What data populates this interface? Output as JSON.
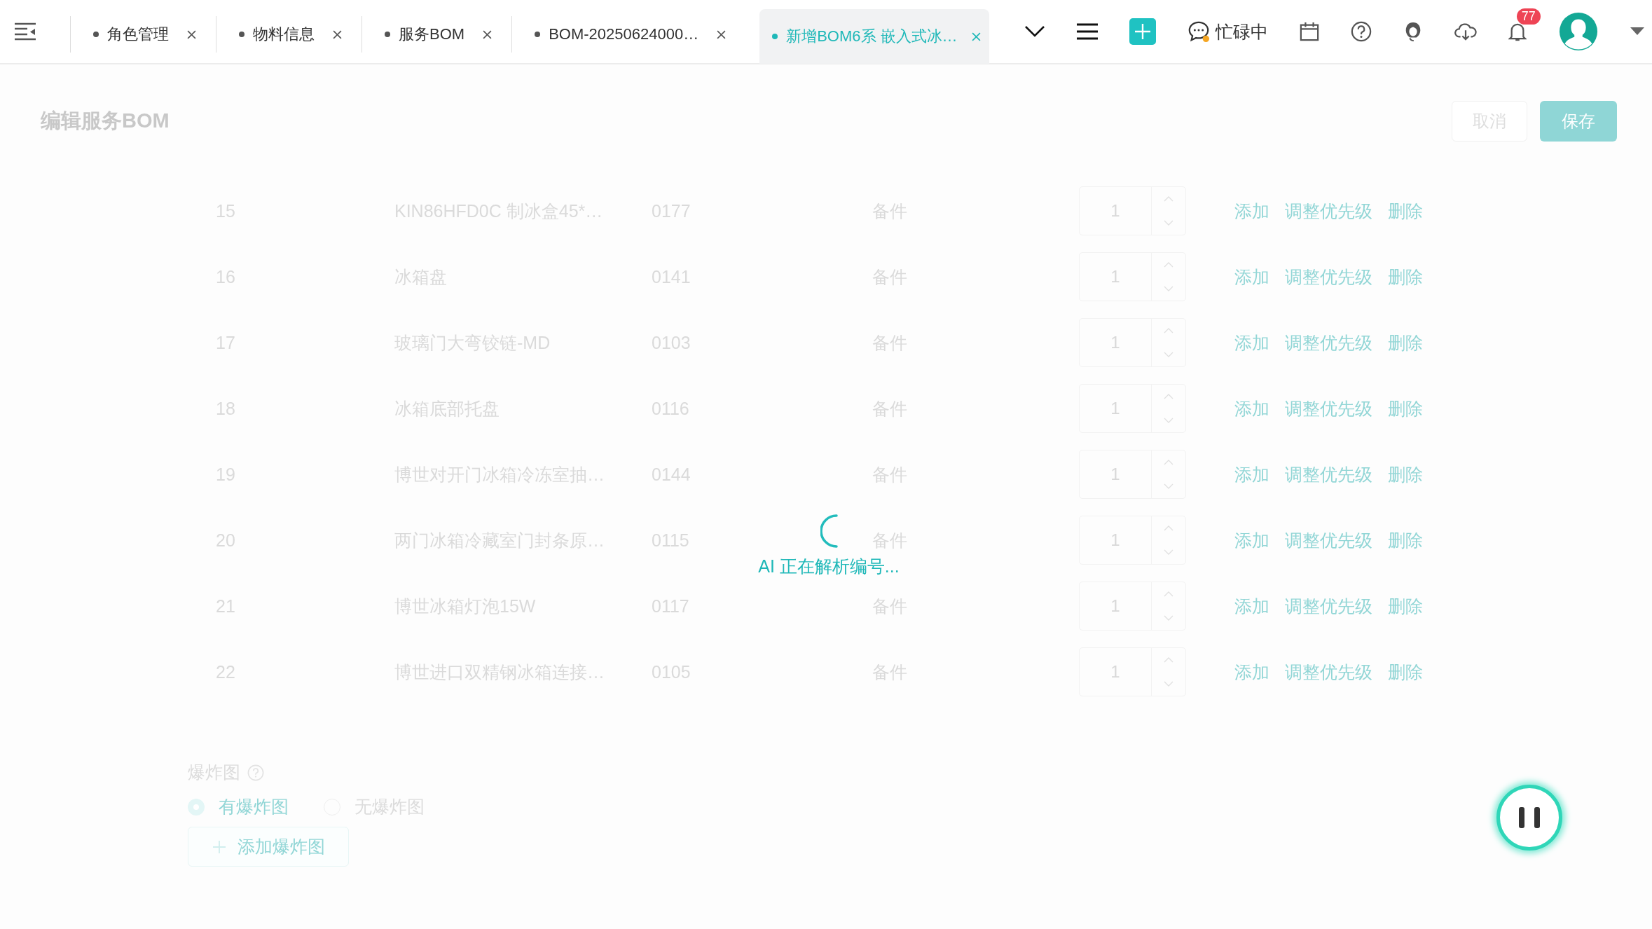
{
  "tabs": [
    {
      "label": "角色管理",
      "selected": false
    },
    {
      "label": "物料信息",
      "selected": false
    },
    {
      "label": "服务BOM",
      "selected": false
    },
    {
      "label": "BOM-20250624000…",
      "selected": false
    },
    {
      "label": "新增BOM6系 嵌入式冰…",
      "selected": true
    }
  ],
  "toolbar": {
    "status": "忙碌中",
    "notification_count": "77"
  },
  "page": {
    "title": "编辑服务BOM",
    "cancel_button": "取消",
    "save_button": "保存"
  },
  "rows": [
    {
      "index": "15",
      "name": "KIN86HFD0C 制冰盒45*…",
      "code": "0177",
      "type": "备件",
      "quantity": "1",
      "actions": [
        "添加",
        "调整优先级",
        "删除"
      ]
    },
    {
      "index": "16",
      "name": "冰箱盘",
      "code": "0141",
      "type": "备件",
      "quantity": "1",
      "actions": [
        "添加",
        "调整优先级",
        "删除"
      ]
    },
    {
      "index": "17",
      "name": "玻璃门大弯铰链-MD",
      "code": "0103",
      "type": "备件",
      "quantity": "1",
      "actions": [
        "添加",
        "调整优先级",
        "删除"
      ]
    },
    {
      "index": "18",
      "name": "冰箱底部托盘",
      "code": "0116",
      "type": "备件",
      "quantity": "1",
      "actions": [
        "添加",
        "调整优先级",
        "删除"
      ]
    },
    {
      "index": "19",
      "name": "博世对开门冰箱冷冻室抽…",
      "code": "0144",
      "type": "备件",
      "quantity": "1",
      "actions": [
        "添加",
        "调整优先级",
        "删除"
      ]
    },
    {
      "index": "20",
      "name": "两门冰箱冷藏室门封条原…",
      "code": "0115",
      "type": "备件",
      "quantity": "1",
      "actions": [
        "添加",
        "调整优先级",
        "删除"
      ]
    },
    {
      "index": "21",
      "name": "博世冰箱灯泡15W",
      "code": "0117",
      "type": "备件",
      "quantity": "1",
      "actions": [
        "添加",
        "调整优先级",
        "删除"
      ]
    },
    {
      "index": "22",
      "name": "博世进口双精钢冰箱连接…",
      "code": "0105",
      "type": "备件",
      "quantity": "1",
      "actions": [
        "添加",
        "调整优先级",
        "删除"
      ]
    }
  ],
  "exploded_view": {
    "label": "爆炸图",
    "options": [
      {
        "label": "有爆炸图",
        "selected": true
      },
      {
        "label": "无爆炸图",
        "selected": false
      }
    ],
    "add_button": "添加爆炸图"
  },
  "loading": {
    "message": "AI 正在解析编号..."
  }
}
